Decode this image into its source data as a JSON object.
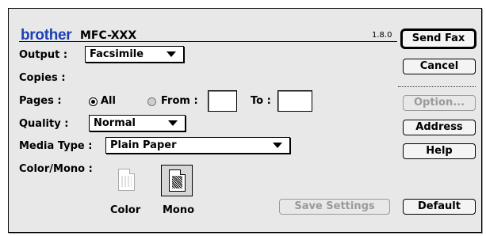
{
  "header": {
    "brand": "brother",
    "model": "MFC-XXX",
    "version": "1.8.0"
  },
  "colors": {
    "brand": "#1a3fb6"
  },
  "form": {
    "output_label": "Output :",
    "output_value": "Facsimile",
    "copies_label": "Copies :",
    "pages_label": "Pages :",
    "pages_all": "All",
    "pages_from": "From :",
    "pages_to": "To :",
    "pages_selected": "All",
    "quality_label": "Quality :",
    "quality_value": "Normal",
    "media_label": "Media Type :",
    "media_value": "Plain Paper",
    "colormono_label": "Color/Mono :",
    "color_caption": "Color",
    "mono_caption": "Mono",
    "colormono_selected": "Mono"
  },
  "buttons": {
    "send_fax": "Send Fax",
    "cancel": "Cancel",
    "option": "Option...",
    "address": "Address",
    "help": "Help",
    "save_settings": "Save Settings",
    "default": "Default"
  },
  "icons": {
    "color": "color-document-icon",
    "mono": "mono-document-icon",
    "dropdown": "chevron-down-icon"
  }
}
